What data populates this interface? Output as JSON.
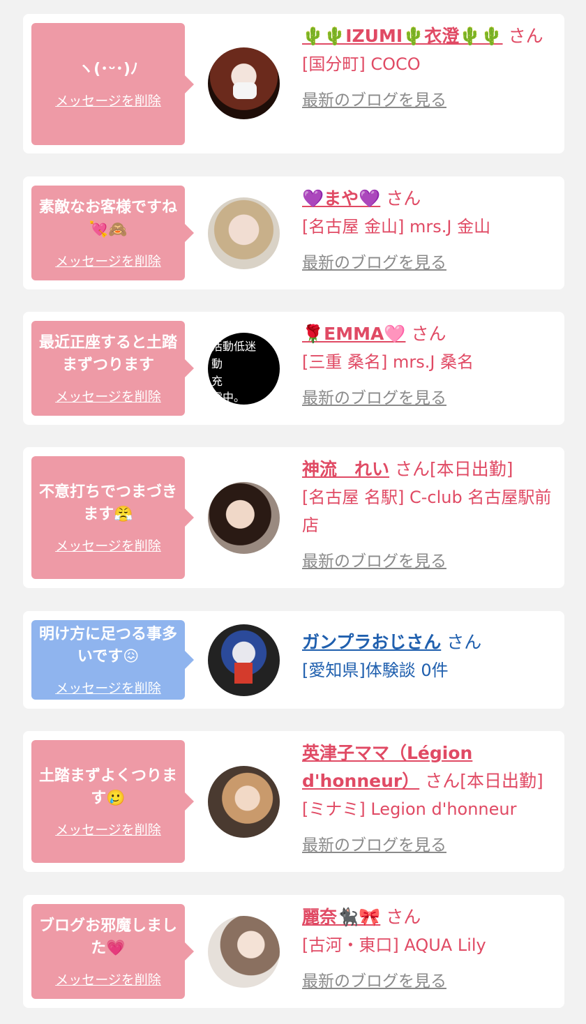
{
  "colors": {
    "pink_bubble": "#ee9aa6",
    "blue_bubble": "#8fb4ee",
    "pink_text": "#e04a64",
    "blue_text": "#1f5fae",
    "blog_link": "#8a8a8a"
  },
  "delete_label": "メッセージを削除",
  "blog_label": "最新のブログを見る",
  "cards": [
    {
      "message": "ヽ(･ᵕ･)ﾉ",
      "name": "🌵🌵IZUMI🌵衣澄🌵🌵",
      "san": "さん",
      "shop": "[国分町] COCO"
    },
    {
      "message": "素敵なお客様ですね💘🙈",
      "name": "💜まや💜",
      "san": "さん",
      "shop": "[名古屋 金山] mrs.J 金山"
    },
    {
      "message": "最近正座すると土踏まずつります",
      "name": "🌹EMMA🩷",
      "san": "さん",
      "shop": "[三重 桑名] mrs.J 桑名"
    },
    {
      "message": "不意打ちでつまづきます😤",
      "name": "神流　れい",
      "san": "さん[本日出勤]",
      "shop": "[名古屋 名駅] C-club 名古屋駅前店"
    },
    {
      "message": "明け方に足つる事多いです😖",
      "name": "ガンプラおじさん",
      "san": "さん",
      "shop": "[愛知県]体験談 0件"
    },
    {
      "message": "土踏まずよくつります🥲",
      "name": "英津子ママ（Légion d'honneur）",
      "san": "さん[本日出勤]",
      "shop": "[ミナミ] Legion d'honneur"
    },
    {
      "message": "ブログお邪魔しました💗",
      "name": "麗奈🐈‍⬛🎀",
      "san": "さん",
      "shop": "[古河・東口] AQUA Lily"
    }
  ]
}
